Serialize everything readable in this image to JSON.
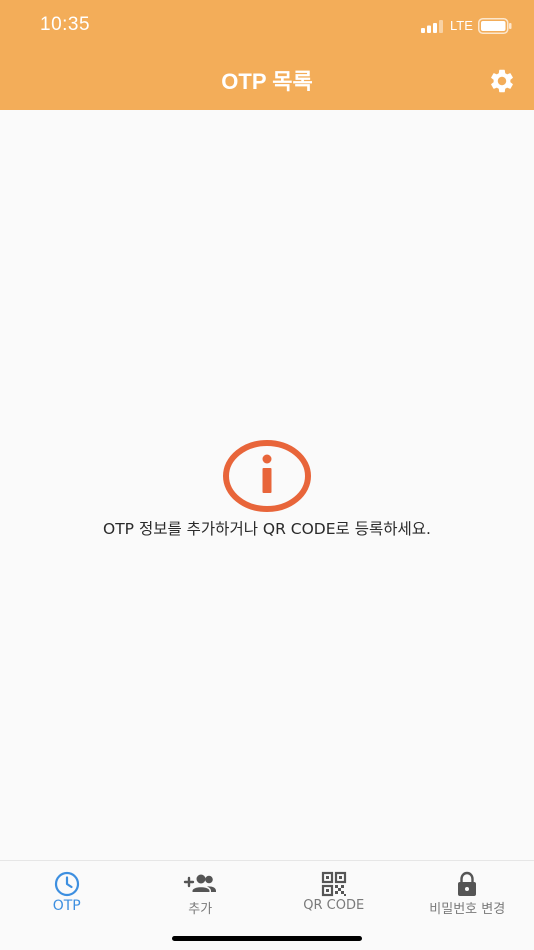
{
  "status_bar": {
    "time": "10:35",
    "network": "LTE"
  },
  "nav": {
    "title": "OTP 목록",
    "settings_icon": "gear-icon"
  },
  "content": {
    "info_icon": "info-icon",
    "empty_message": "OTP 정보를 추가하거나 QR CODE로 등록하세요."
  },
  "tabs": [
    {
      "label": "OTP",
      "icon": "clock-icon",
      "active": true
    },
    {
      "label": "추가",
      "icon": "add-user-icon",
      "active": false
    },
    {
      "label": "QR CODE",
      "icon": "qr-code-icon",
      "active": false
    },
    {
      "label": "비밀번호 변경",
      "icon": "lock-icon",
      "active": false
    }
  ],
  "colors": {
    "header": "#f3ad59",
    "accent": "#3d8fe0",
    "info": "#e8653a",
    "tab_inactive": "#7a7a7a"
  }
}
